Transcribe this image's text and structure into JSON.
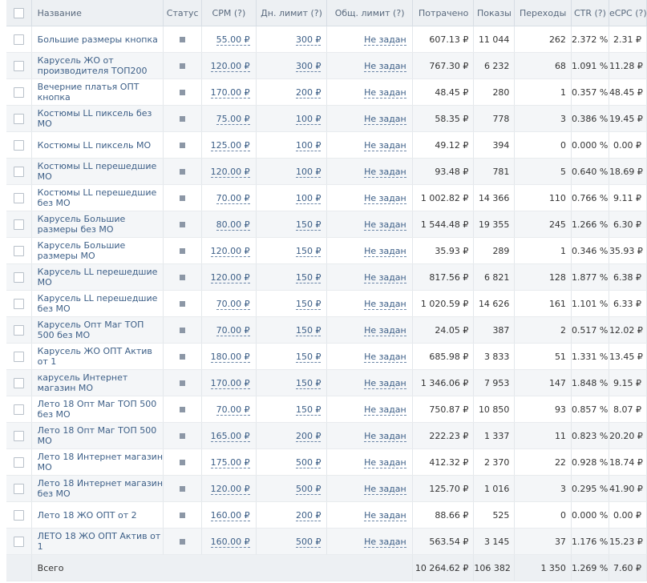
{
  "header": {
    "name": "Название",
    "status": "Статус",
    "cpm": "CPM (?)",
    "daily_limit": "Дн. лимит (?)",
    "total_limit": "Общ. лимит (?)",
    "spent": "Потрачено",
    "shows": "Показы",
    "clicks": "Переходы",
    "ctr": "CTR (?)",
    "ecpc": "eCPC (?)"
  },
  "rows": [
    {
      "name": "Большие размеры кнопка",
      "cpm": "55.00 ₽",
      "daily_limit": "300 ₽",
      "total_limit": "Не задан",
      "spent": "607.13 ₽",
      "shows": "11 044",
      "clicks": "262",
      "ctr": "2.372 %",
      "ecpc": "2.31 ₽"
    },
    {
      "name": "Карусель ЖО от производителя ТОП200",
      "cpm": "120.00 ₽",
      "daily_limit": "300 ₽",
      "total_limit": "Не задан",
      "spent": "767.30 ₽",
      "shows": "6 232",
      "clicks": "68",
      "ctr": "1.091 %",
      "ecpc": "11.28 ₽"
    },
    {
      "name": "Вечерние платья ОПТ кнопка",
      "cpm": "170.00 ₽",
      "daily_limit": "200 ₽",
      "total_limit": "Не задан",
      "spent": "48.45 ₽",
      "shows": "280",
      "clicks": "1",
      "ctr": "0.357 %",
      "ecpc": "48.45 ₽"
    },
    {
      "name": "Костюмы LL пиксель без МО",
      "cpm": "75.00 ₽",
      "daily_limit": "100 ₽",
      "total_limit": "Не задан",
      "spent": "58.35 ₽",
      "shows": "778",
      "clicks": "3",
      "ctr": "0.386 %",
      "ecpc": "19.45 ₽"
    },
    {
      "name": "Костюмы LL пиксель МО",
      "cpm": "125.00 ₽",
      "daily_limit": "100 ₽",
      "total_limit": "Не задан",
      "spent": "49.12 ₽",
      "shows": "394",
      "clicks": "0",
      "ctr": "0.000 %",
      "ecpc": "0.00 ₽"
    },
    {
      "name": "Костюмы LL перешедшие МО",
      "cpm": "120.00 ₽",
      "daily_limit": "100 ₽",
      "total_limit": "Не задан",
      "spent": "93.48 ₽",
      "shows": "781",
      "clicks": "5",
      "ctr": "0.640 %",
      "ecpc": "18.69 ₽"
    },
    {
      "name": "Костюмы LL перешедшие без МО",
      "cpm": "70.00 ₽",
      "daily_limit": "100 ₽",
      "total_limit": "Не задан",
      "spent": "1 002.82 ₽",
      "shows": "14 366",
      "clicks": "110",
      "ctr": "0.766 %",
      "ecpc": "9.11 ₽"
    },
    {
      "name": "Карусель Большие размеры без МО",
      "cpm": "80.00 ₽",
      "daily_limit": "150 ₽",
      "total_limit": "Не задан",
      "spent": "1 544.48 ₽",
      "shows": "19 355",
      "clicks": "245",
      "ctr": "1.266 %",
      "ecpc": "6.30 ₽"
    },
    {
      "name": "Карусель Большие размеры МО",
      "cpm": "120.00 ₽",
      "daily_limit": "150 ₽",
      "total_limit": "Не задан",
      "spent": "35.93 ₽",
      "shows": "289",
      "clicks": "1",
      "ctr": "0.346 %",
      "ecpc": "35.93 ₽"
    },
    {
      "name": "Карусель LL перешедшие МО",
      "cpm": "120.00 ₽",
      "daily_limit": "150 ₽",
      "total_limit": "Не задан",
      "spent": "817.56 ₽",
      "shows": "6 821",
      "clicks": "128",
      "ctr": "1.877 %",
      "ecpc": "6.38 ₽"
    },
    {
      "name": "Карусель LL перешедшие без МО",
      "cpm": "70.00 ₽",
      "daily_limit": "150 ₽",
      "total_limit": "Не задан",
      "spent": "1 020.59 ₽",
      "shows": "14 626",
      "clicks": "161",
      "ctr": "1.101 %",
      "ecpc": "6.33 ₽"
    },
    {
      "name": "Карусель Опт Маг ТОП 500 без МО",
      "cpm": "70.00 ₽",
      "daily_limit": "150 ₽",
      "total_limit": "Не задан",
      "spent": "24.05 ₽",
      "shows": "387",
      "clicks": "2",
      "ctr": "0.517 %",
      "ecpc": "12.02 ₽"
    },
    {
      "name": "Карусель ЖО ОПТ Актив от 1",
      "cpm": "180.00 ₽",
      "daily_limit": "150 ₽",
      "total_limit": "Не задан",
      "spent": "685.98 ₽",
      "shows": "3 833",
      "clicks": "51",
      "ctr": "1.331 %",
      "ecpc": "13.45 ₽"
    },
    {
      "name": "карусель Интернет магазин МО",
      "cpm": "170.00 ₽",
      "daily_limit": "150 ₽",
      "total_limit": "Не задан",
      "spent": "1 346.06 ₽",
      "shows": "7 953",
      "clicks": "147",
      "ctr": "1.848 %",
      "ecpc": "9.15 ₽"
    },
    {
      "name": "Лето 18 Опт Маг ТОП 500 без МО",
      "cpm": "70.00 ₽",
      "daily_limit": "150 ₽",
      "total_limit": "Не задан",
      "spent": "750.87 ₽",
      "shows": "10 850",
      "clicks": "93",
      "ctr": "0.857 %",
      "ecpc": "8.07 ₽"
    },
    {
      "name": "Лето 18 Опт Маг ТОП 500 МО",
      "cpm": "165.00 ₽",
      "daily_limit": "200 ₽",
      "total_limit": "Не задан",
      "spent": "222.23 ₽",
      "shows": "1 337",
      "clicks": "11",
      "ctr": "0.823 %",
      "ecpc": "20.20 ₽"
    },
    {
      "name": "Лето 18 Интернет магазин МО",
      "cpm": "175.00 ₽",
      "daily_limit": "500 ₽",
      "total_limit": "Не задан",
      "spent": "412.32 ₽",
      "shows": "2 370",
      "clicks": "22",
      "ctr": "0.928 %",
      "ecpc": "18.74 ₽"
    },
    {
      "name": "Лето 18 Интернет магазин без МО",
      "cpm": "120.00 ₽",
      "daily_limit": "500 ₽",
      "total_limit": "Не задан",
      "spent": "125.70 ₽",
      "shows": "1 016",
      "clicks": "3",
      "ctr": "0.295 %",
      "ecpc": "41.90 ₽"
    },
    {
      "name": "Лето 18 ЖО ОПТ от 2",
      "cpm": "160.00 ₽",
      "daily_limit": "200 ₽",
      "total_limit": "Не задан",
      "spent": "88.66 ₽",
      "shows": "525",
      "clicks": "0",
      "ctr": "0.000 %",
      "ecpc": "0.00 ₽"
    },
    {
      "name": "ЛЕТО 18 ЖО ОПТ Актив от 1",
      "cpm": "160.00 ₽",
      "daily_limit": "500 ₽",
      "total_limit": "Не задан",
      "spent": "563.54 ₽",
      "shows": "3 145",
      "clicks": "37",
      "ctr": "1.176 %",
      "ecpc": "15.23 ₽"
    }
  ],
  "totals": {
    "label": "Всего",
    "spent": "10 264.62 ₽",
    "shows": "106 382",
    "clicks": "1 350",
    "ctr": "1.269 %",
    "ecpc": "7.60 ₽"
  },
  "icons": {
    "checkbox": "checkbox-icon",
    "status": "status-square-icon"
  },
  "colors": {
    "link": "#3d5f87",
    "header_bg": "#edf0f3",
    "stripe_bg": "#f4f6f8",
    "status_square": "#8c97a6"
  }
}
